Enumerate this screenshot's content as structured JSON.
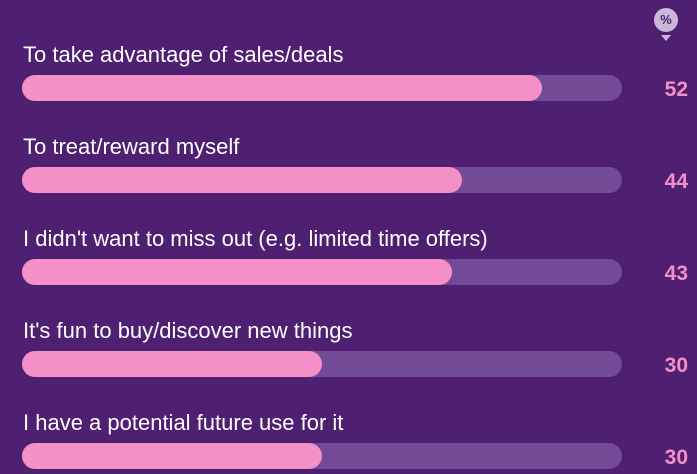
{
  "unit_badge": "%",
  "colors": {
    "background": "#4f1f72",
    "track": "#734a96",
    "bar": "#f58fc8",
    "value_text": "#f58fc8",
    "label_text": "#ffffff"
  },
  "chart_data": {
    "type": "bar",
    "orientation": "horizontal",
    "unit": "%",
    "max": 60,
    "categories": [
      "To take advantage of sales/deals",
      "To treat/reward myself",
      "I didn't want to miss out (e.g. limited time offers)",
      "It's fun to buy/discover new things",
      "I have a potential future use for it"
    ],
    "values": [
      52,
      44,
      43,
      30,
      30
    ]
  }
}
